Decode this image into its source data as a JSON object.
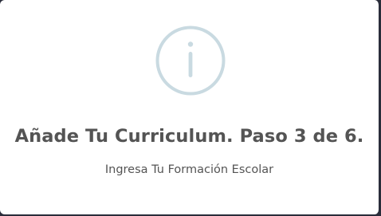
{
  "dialog": {
    "icon": "info-icon",
    "title": "Añade Tu Curriculum. Paso 3 de 6.",
    "subtitle": "Ingresa Tu Formación Escolar"
  },
  "colors": {
    "icon_stroke": "#c9dae1",
    "text": "#545454",
    "background": "#ffffff",
    "backdrop": "#2a2d3a"
  }
}
